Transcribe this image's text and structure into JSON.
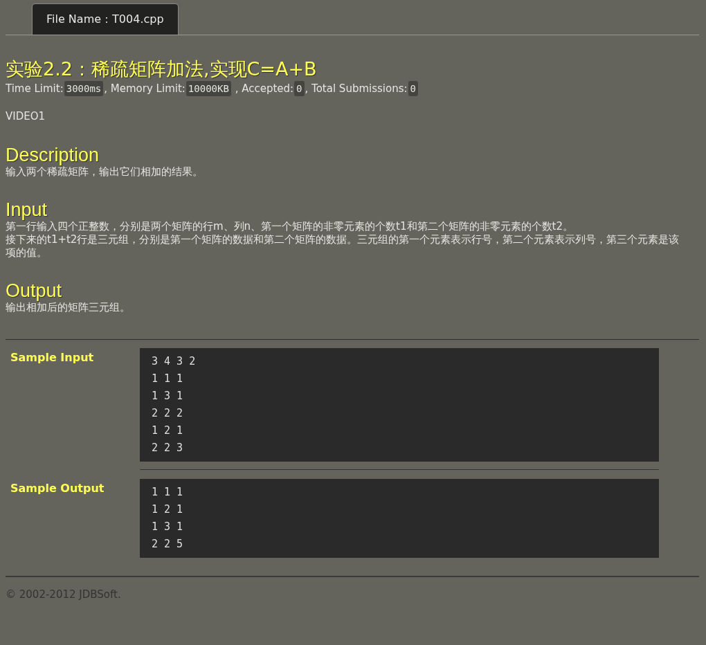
{
  "tabs": [
    {
      "label": "File Name：T004.cpp",
      "selected": true
    }
  ],
  "title": "实验2.2：稀疏矩阵加法,实现C=A+B",
  "limits": [
    {
      "label": "Time Limit:",
      "value": "3000ms"
    },
    {
      "label": ", Memory Limit:",
      "value": "10000KB"
    },
    {
      "label": " , Accepted:",
      "value": "0"
    },
    {
      "label": ", Total Submissions:",
      "value": "0"
    }
  ],
  "note": "VIDEO1",
  "sections": [
    {
      "heading": "Description",
      "paragraphs": [
        "输入两个稀疏矩阵，输出它们相加的结果。"
      ]
    },
    {
      "heading": "Input",
      "paragraphs": [
        "第一行输入四个正整数，分别是两个矩阵的行m、列n、第一个矩阵的非零元素的个数t1和第二个矩阵的非零元素的个数t2。",
        "接下来的t1+t2行是三元组，分别是第一个矩阵的数据和第二个矩阵的数据。三元组的第一个元素表示行号，第二个元素表示列号，第三个元素是该项的值。"
      ]
    },
    {
      "heading": "Output",
      "paragraphs": [
        "输出相加后的矩阵三元组。"
      ]
    }
  ],
  "samples": [
    {
      "label": "Sample Input",
      "lines": [
        "3 4 3 2",
        "1 1 1",
        "1 3 1",
        "2 2 2",
        "1 2 1",
        "2 2 3"
      ]
    },
    {
      "label": "Sample Output",
      "lines": [
        "1 1 1",
        "1 2 1",
        "1 3 1",
        "2 2 5"
      ]
    }
  ],
  "footer": "© 2002-2012  JDBSoft."
}
